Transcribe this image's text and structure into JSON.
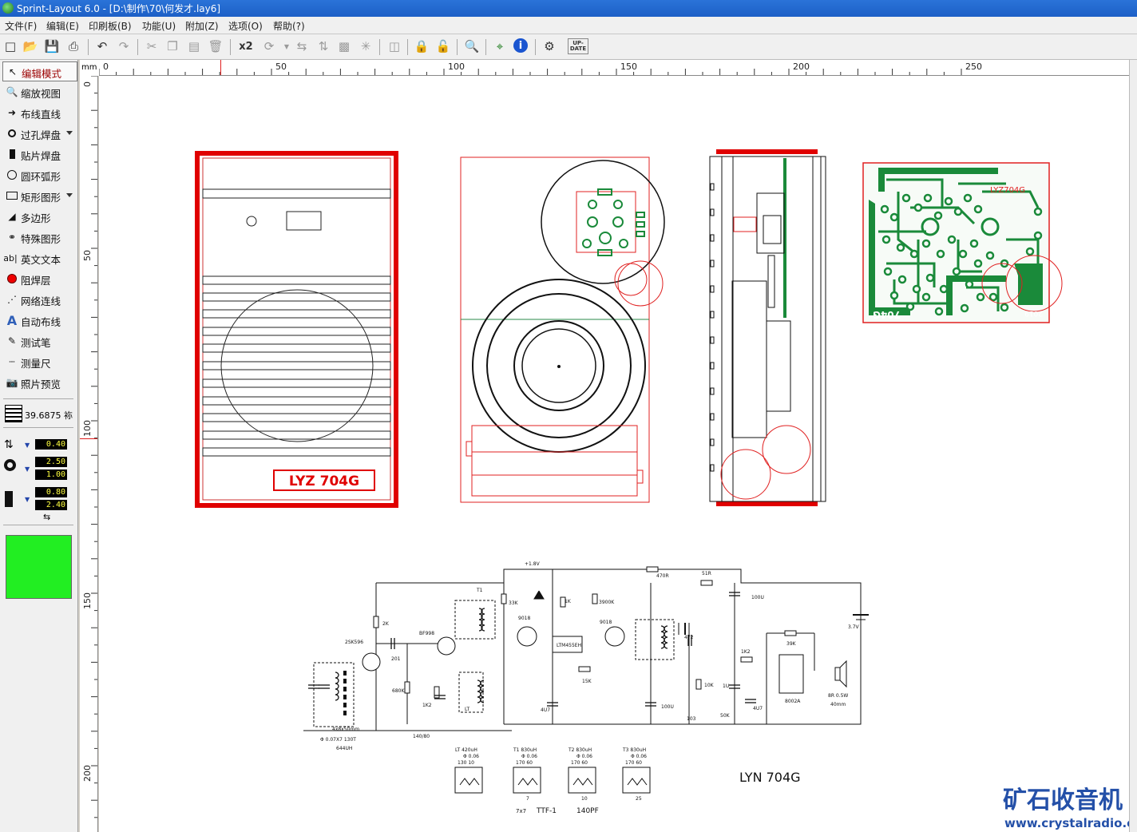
{
  "window": {
    "title": "Sprint-Layout 6.0 - [D:\\制作\\70\\何发才.lay6]"
  },
  "menu": [
    "文件(F)",
    "编辑(E)",
    "印刷板(B)",
    "功能(U)",
    "附加(Z)",
    "选项(O)",
    "帮助(?)"
  ],
  "toolbar": {
    "x2_label": "x2",
    "update_label_1": "UP-",
    "update_label_2": "DATE"
  },
  "tools": [
    {
      "label": "编辑模式",
      "icon": "pointer-icon",
      "selected": true
    },
    {
      "label": "缩放视图",
      "icon": "zoom-icon"
    },
    {
      "label": "布线直线",
      "icon": "track-icon"
    },
    {
      "label": "过孔焊盘",
      "icon": "pad-icon",
      "dropdown": true
    },
    {
      "label": "贴片焊盘",
      "icon": "smd-pad-icon"
    },
    {
      "label": "圆环弧形",
      "icon": "circle-icon"
    },
    {
      "label": "矩形图形",
      "icon": "rectangle-icon",
      "dropdown": true
    },
    {
      "label": "多边形",
      "icon": "polygon-icon"
    },
    {
      "label": "特殊图形",
      "icon": "special-shape-icon"
    },
    {
      "label": "英文文本",
      "icon": "text-icon",
      "icon_text": "ab|"
    },
    {
      "label": "阻焊层",
      "icon": "solder-mask-icon"
    },
    {
      "label": "网络连线",
      "icon": "netlist-icon"
    },
    {
      "label": "自动布线",
      "icon": "autoroute-icon",
      "icon_text": "A"
    },
    {
      "label": "测试笔",
      "icon": "probe-icon"
    },
    {
      "label": "测量尺",
      "icon": "ruler-icon"
    },
    {
      "label": "照片预览",
      "icon": "camera-icon"
    }
  ],
  "grid": {
    "value": "39.6875 袮"
  },
  "settings": {
    "track_width": "0.40",
    "pad_outer": "2.50",
    "pad_inner": "1.00",
    "smd_width": "0.80",
    "smd_height": "2.40"
  },
  "layer_color": "#22ee22",
  "ruler": {
    "unit": "mm",
    "top_ticks": [
      {
        "value": "0",
        "pos": 0
      },
      {
        "value": "50",
        "pos": 216
      },
      {
        "value": "100",
        "pos": 432
      },
      {
        "value": "150",
        "pos": 648
      },
      {
        "value": "200",
        "pos": 864
      },
      {
        "value": "250",
        "pos": 1080
      }
    ],
    "left_ticks": [
      {
        "value": "0"
      },
      {
        "value": "50"
      },
      {
        "value": "100"
      },
      {
        "value": "150"
      },
      {
        "value": "200"
      }
    ]
  },
  "drawing": {
    "front_label": "LYZ 704G",
    "pcb_label_top": "LYZ704G",
    "pcb_label_bottom_left": "704G",
    "pcb_label_bottom_right": "2019",
    "schematic_title": "LYN 704G",
    "schematic_labels": [
      "+1.8V",
      "470R",
      "51R",
      "100U",
      "33K",
      "1K",
      "3900K",
      "9018",
      "9018",
      "2K",
      "BF998",
      "2SK596",
      "201",
      "LTM455EH",
      "472",
      "3.7V",
      "15K",
      "39K",
      "1K2",
      "8002A",
      "10K",
      "50K",
      "1U",
      "4U7",
      "4U7",
      "103",
      "100U",
      "680K",
      "1K2",
      "LT",
      "T1",
      "8R 0.5W",
      "40mm",
      "4x8x50mm",
      "Φ 0.07X7 130T",
      "644UH",
      "140/80"
    ],
    "coil_specs": [
      {
        "name": "LT 420uH",
        "wire": "Φ 0.06",
        "turns": "130  10",
        "pin": ""
      },
      {
        "name": "T1 830uH",
        "wire": "Φ 0.06",
        "turns": "170  60",
        "pin": "7"
      },
      {
        "name": "T2 830uH",
        "wire": "Φ 0.06",
        "turns": "170  60",
        "pin": "10"
      },
      {
        "name": "T3 830uH",
        "wire": "Φ 0.06",
        "turns": "170  60",
        "pin": "25"
      }
    ],
    "coil_notes": [
      "7x7",
      "TTF-1",
      "140PF"
    ]
  },
  "watermark": {
    "title": "矿石收音机",
    "url": "www.crystalradio.cn"
  }
}
